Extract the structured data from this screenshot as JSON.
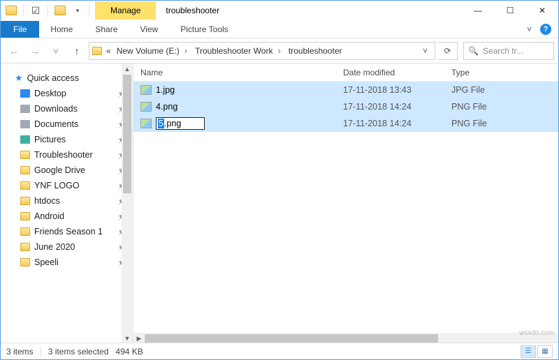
{
  "title": "troubleshooter",
  "context_tab": "Manage",
  "context_group": "Picture Tools",
  "tabs": {
    "file": "File",
    "home": "Home",
    "share": "Share",
    "view": "View"
  },
  "ribbon_expand_glyph": "˅",
  "window_controls": {
    "min": "—",
    "max": "☐",
    "close": "✕"
  },
  "nav": {
    "back": "←",
    "forward": "→",
    "recent": "˅",
    "up": "↑"
  },
  "breadcrumbs": {
    "overflow": "«",
    "items": [
      "New Volume (E:)",
      "Troubleshooter Work",
      "troubleshooter"
    ]
  },
  "refresh_glyph": "⟳",
  "search": {
    "placeholder": "Search tr..."
  },
  "sidebar": {
    "header": "Quick access",
    "items": [
      {
        "label": "Desktop",
        "icon": "blue"
      },
      {
        "label": "Downloads",
        "icon": "gray"
      },
      {
        "label": "Documents",
        "icon": "gray"
      },
      {
        "label": "Pictures",
        "icon": "teal"
      },
      {
        "label": "Troubleshooter",
        "icon": "folder"
      },
      {
        "label": "Google Drive",
        "icon": "folder"
      },
      {
        "label": "YNF LOGO",
        "icon": "folder"
      },
      {
        "label": "htdocs",
        "icon": "folder"
      },
      {
        "label": "Android",
        "icon": "folder"
      },
      {
        "label": "Friends Season 1",
        "icon": "folder"
      },
      {
        "label": "June 2020",
        "icon": "folder"
      },
      {
        "label": "Speeli",
        "icon": "folder"
      }
    ]
  },
  "columns": {
    "name": "Name",
    "date": "Date modified",
    "type": "Type"
  },
  "files": [
    {
      "name": "1.jpg",
      "date": "17-11-2018 13:43",
      "type": "JPG File",
      "editing": false
    },
    {
      "name": "4.png",
      "date": "17-11-2018 14:24",
      "type": "PNG File",
      "editing": false
    },
    {
      "name_sel": "5",
      "name_rest": ".png",
      "date": "17-11-2018 14:24",
      "type": "PNG File",
      "editing": true
    }
  ],
  "status": {
    "count": "3 items",
    "selected": "3 items selected",
    "size": "494 KB"
  },
  "watermark": "wsxdn.com"
}
